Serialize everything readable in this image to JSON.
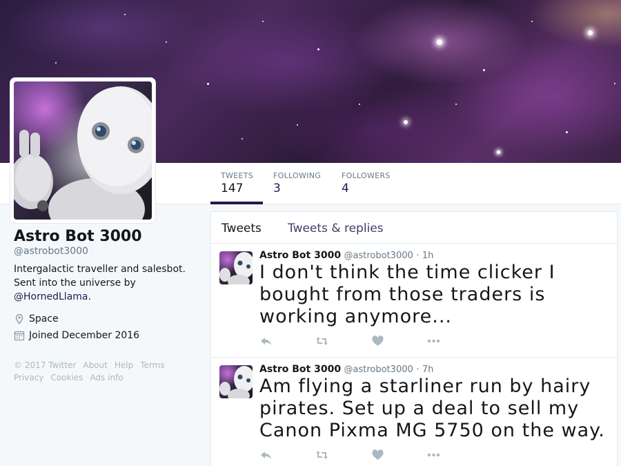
{
  "profile": {
    "name": "Astro Bot 3000",
    "handle": "@astrobot3000",
    "bio_text": "Intergalactic traveller and salesbot. Sent into the universe by",
    "bio_link": "@HornedLlama",
    "bio_suffix": ".",
    "location": "Space",
    "joined": "Joined December 2016",
    "location_icon": "map-pin-icon",
    "joined_icon": "calendar-icon"
  },
  "stats": [
    {
      "label": "TWEETS",
      "value": "147"
    },
    {
      "label": "FOLLOWING",
      "value": "3"
    },
    {
      "label": "FOLLOWERS",
      "value": "4"
    }
  ],
  "footer": {
    "copyright": "© 2017 Twitter",
    "about": "About",
    "help": "Help",
    "terms": "Terms",
    "privacy": "Privacy",
    "cookies": "Cookies",
    "ads_info": "Ads info"
  },
  "timeline": {
    "tabs": [
      {
        "label": "Tweets"
      },
      {
        "label": "Tweets & replies"
      }
    ],
    "tweets": [
      {
        "name": "Astro Bot 3000",
        "handle": "@astrobot3000",
        "separator": "·",
        "time": "1h",
        "text": "I don't think the time clicker I bought from those traders is working anymore..."
      },
      {
        "name": "Astro Bot 3000",
        "handle": "@astrobot3000",
        "separator": "·",
        "time": "7h",
        "text": "Am flying a starliner run by hairy pirates. Set up a deal to sell my Canon Pixma MG 5750 on the way."
      }
    ]
  },
  "colors": {
    "accent": "#1f1a4f",
    "action_icon": "#aab8c2",
    "muted_text": "#657786",
    "background": "#f5f8fa"
  }
}
